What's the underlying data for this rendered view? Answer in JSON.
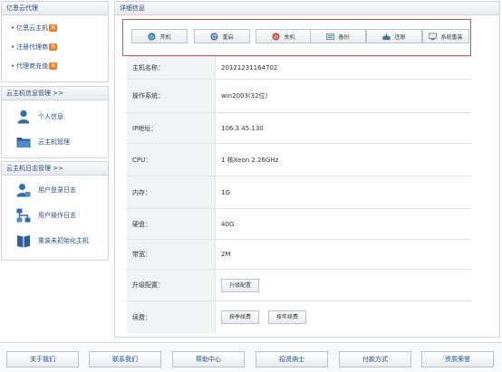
{
  "sidebar": {
    "agency_panel": {
      "title": "亿恩云代理",
      "items": [
        {
          "label": "亿恩云主机",
          "badge": "热"
        },
        {
          "label": "注册代理商",
          "badge": "热"
        },
        {
          "label": "代理商充值",
          "badge": "热"
        }
      ]
    },
    "manage_panel": {
      "title": "云主机信息管理 >>",
      "items": [
        {
          "label": "个人信息",
          "icon": "user-icon"
        },
        {
          "label": "云主机管理",
          "icon": "folder-icon"
        }
      ]
    },
    "log_panel": {
      "title": "云主机日志管理 >>",
      "items": [
        {
          "label": "用户登录日志",
          "icon": "user-login-icon"
        },
        {
          "label": "用户操作日志",
          "icon": "network-icon"
        },
        {
          "label": "重装未初始化主机",
          "icon": "book-icon"
        }
      ]
    }
  },
  "detail": {
    "title": "详细信息",
    "controls": [
      {
        "label": "开机",
        "icon": "power-on-icon"
      },
      {
        "label": "重启",
        "icon": "restart-icon"
      },
      {
        "label": "关机",
        "icon": "power-off-icon"
      },
      {
        "label": "备份",
        "icon": "backup-icon"
      },
      {
        "label": "还原",
        "icon": "restore-icon"
      },
      {
        "label": "系统重装",
        "icon": "reinstall-icon"
      }
    ],
    "rows": {
      "hostname": {
        "label": "主机名称：",
        "value": "20121231164702"
      },
      "os": {
        "label": "操作系统：",
        "value": "win2003(32位)"
      },
      "ip": {
        "label": "IP地址：",
        "value": "106.3.45.130"
      },
      "cpu": {
        "label": "CPU：",
        "value": "1 核Xeon  2.26GHz"
      },
      "memory": {
        "label": "内存：",
        "value": "1G"
      },
      "disk": {
        "label": "硬盘：",
        "value": "40G"
      },
      "bandwidth": {
        "label": "带宽：",
        "value": "2M"
      },
      "upgrade": {
        "label": "升级配置：",
        "button": "升级配置"
      },
      "renew": {
        "label": "续费：",
        "button_month": "按季续费",
        "button_year": "按年续费"
      }
    }
  },
  "footer": {
    "items": [
      "关于我们",
      "联系我们",
      "帮助中心",
      "招贤纳士",
      "付款方式",
      "资质荣誉"
    ]
  },
  "colors": {
    "accent": "#1f4f8f",
    "highlight_border": "#e04a4a",
    "hot_badge": "#f07a1c"
  }
}
